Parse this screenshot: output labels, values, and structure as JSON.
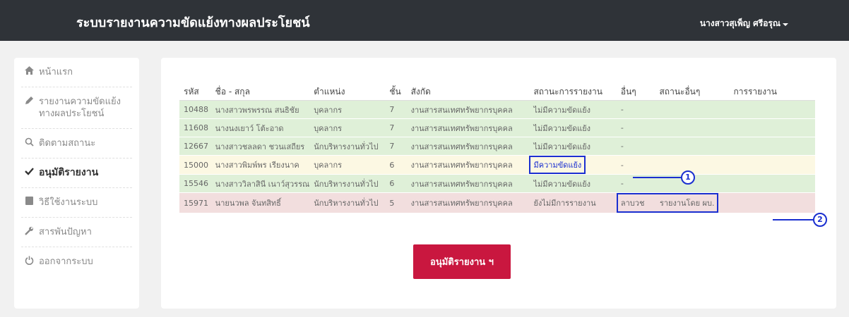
{
  "header": {
    "title": "ระบบรายงานความขัดแย้งทางผลประโยชน์",
    "user": "นางสาวสุเพ็ญ ศรีอรุณ"
  },
  "sidebar": {
    "items": [
      {
        "icon": "home-icon",
        "label": "หน้าแรก"
      },
      {
        "icon": "pencil-icon",
        "label": "รายงานความขัดแย้งทางผลประโยชน์"
      },
      {
        "icon": "search-icon",
        "label": "ติดตามสถานะ"
      },
      {
        "icon": "check-icon",
        "label": "อนุมัติรายงาน"
      },
      {
        "icon": "book-icon",
        "label": "วิธีใช้งานระบบ"
      },
      {
        "icon": "wrench-icon",
        "label": "สารพันปัญหา"
      },
      {
        "icon": "power-icon",
        "label": "ออกจากระบบ"
      }
    ]
  },
  "table": {
    "headers": [
      "รหัส",
      "ชื่อ - สกุล",
      "ตำแหน่ง",
      "ชั้น",
      "สังกัด",
      "สถานะการรายงาน",
      "อื่นๆ",
      "สถานะอื่นๆ",
      "การรายงาน"
    ],
    "rows": [
      {
        "id": "10488",
        "name": "นางสาวพรพรรณ สนธิชัย",
        "position": "บุคลากร",
        "level": "7",
        "dept": "งานสารสนเทศทรัพยากรบุคคล",
        "status": "ไม่มีความขัดแย้ง",
        "other": "-",
        "other_status": "",
        "report": ""
      },
      {
        "id": "11608",
        "name": "นางนงเยาว์ โต้ะอาด",
        "position": "บุคลากร",
        "level": "7",
        "dept": "งานสารสนเทศทรัพยากรบุคคล",
        "status": "ไม่มีความขัดแย้ง",
        "other": "-",
        "other_status": "",
        "report": ""
      },
      {
        "id": "12667",
        "name": "นางสาวชลลดา ชวนเสถียร",
        "position": "นักบริหารงานทั่วไป",
        "level": "7",
        "dept": "งานสารสนเทศทรัพยากรบุคคล",
        "status": "ไม่มีความขัดแย้ง",
        "other": "-",
        "other_status": "",
        "report": ""
      },
      {
        "id": "15000",
        "name": "นางสาวพิมพ์พร เรียงนาค",
        "position": "บุคลากร",
        "level": "6",
        "dept": "งานสารสนเทศทรัพยากรบุคคล",
        "status": "มีความขัดแย้ง",
        "other": "-",
        "other_status": "",
        "report": ""
      },
      {
        "id": "15546",
        "name": "นางสาววิลาสินี เนาว์สุวรรณ",
        "position": "นักบริหารงานทั่วไป",
        "level": "6",
        "dept": "งานสารสนเทศทรัพยากรบุคคล",
        "status": "ไม่มีความขัดแย้ง",
        "other": "-",
        "other_status": "",
        "report": ""
      },
      {
        "id": "15971",
        "name": "นายนวพล จันทสิทธิ์",
        "position": "นักบริหารงานทั่วไป",
        "level": "5",
        "dept": "งานสารสนเทศทรัพยากรบุคคล",
        "status": "ยังไม่มีการรายงาน",
        "other": "ลาบวช",
        "other_status": "รายงานโดย ผบ.",
        "report": ""
      }
    ]
  },
  "callouts": [
    "1",
    "2"
  ],
  "approve_button": "อนุมัติรายงาน ฯ",
  "colors": {
    "header_bg": "#2f3338",
    "row_ok": "#dff0d8",
    "row_warn": "#fcf8e3",
    "row_bad": "#f2dede",
    "button": "#c9173f",
    "annotation": "#1a2fd0"
  }
}
